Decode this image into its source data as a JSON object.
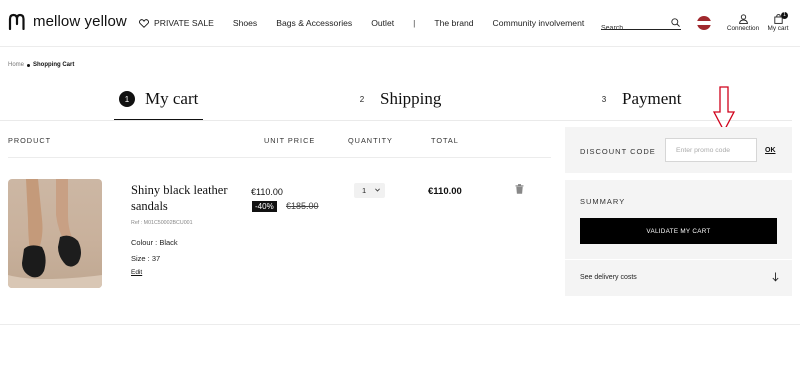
{
  "header": {
    "brand": "mellow yellow",
    "nav": {
      "private_sale": "PRIVATE SALE",
      "shoes": "Shoes",
      "bags": "Bags & Accessories",
      "outlet": "Outlet",
      "separator": "|",
      "brand_link": "The brand",
      "community": "Community involvement"
    },
    "search_placeholder": "Search",
    "connection": "Connection",
    "my_cart": "My cart",
    "cart_count": "1"
  },
  "breadcrumb": {
    "home": "Home",
    "current": "Shopping Cart"
  },
  "steps": [
    {
      "num": "1",
      "label": "My cart",
      "active": true
    },
    {
      "num": "2",
      "label": "Shipping",
      "active": false
    },
    {
      "num": "3",
      "label": "Payment",
      "active": false
    }
  ],
  "table": {
    "headers": {
      "product": "PRODUCT",
      "unit_price": "UNIT PRICE",
      "quantity": "QUANTITY",
      "total": "TOTAL"
    },
    "item": {
      "name": "Shiny black leather sandals",
      "ref": "Ref : M01C50002BCU001",
      "colour": "Colour : Black",
      "size": "Size : 37",
      "edit": "Edit",
      "unit_price": "€110.00",
      "discount": "-40%",
      "old_price": "€185.00",
      "quantity": "1",
      "total": "€110.00"
    }
  },
  "sidebar": {
    "discount_label": "DISCOUNT CODE",
    "discount_placeholder": "Enter promo code",
    "ok": "OK",
    "summary_label": "SUMMARY",
    "validate": "VALIDATE MY CART",
    "delivery": "See delivery costs"
  },
  "colors": {
    "accent": "#000000",
    "panel_bg": "#f4f4f4",
    "annotation_arrow": "#d0021b"
  }
}
